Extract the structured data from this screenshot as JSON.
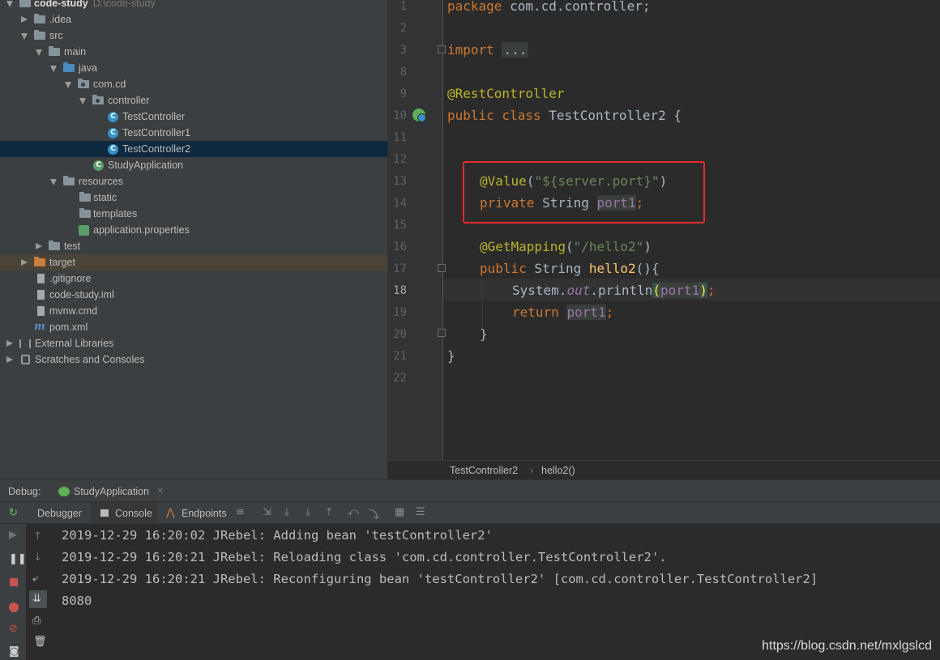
{
  "project_tree": {
    "root_label": "code-study",
    "root_path": "D:\\code-study",
    "items": [
      {
        "label": ".idea"
      },
      {
        "label": "src"
      },
      {
        "label": "main"
      },
      {
        "label": "java"
      },
      {
        "label": "com.cd"
      },
      {
        "label": "controller"
      },
      {
        "label": "TestController"
      },
      {
        "label": "TestController1"
      },
      {
        "label": "TestController2"
      },
      {
        "label": "StudyApplication"
      },
      {
        "label": "resources"
      },
      {
        "label": "static"
      },
      {
        "label": "templates"
      },
      {
        "label": "application.properties"
      },
      {
        "label": "test"
      },
      {
        "label": "target"
      },
      {
        "label": ".gitignore"
      },
      {
        "label": "code-study.iml"
      },
      {
        "label": "mvnw.cmd"
      },
      {
        "label": "pom.xml"
      },
      {
        "label": "External Libraries"
      },
      {
        "label": "Scratches and Consoles"
      }
    ]
  },
  "editor": {
    "line_numbers": [
      "1",
      "2",
      "3",
      "8",
      "9",
      "10",
      "11",
      "12",
      "13",
      "14",
      "15",
      "16",
      "17",
      "18",
      "19",
      "20",
      "21",
      "22"
    ],
    "code": {
      "l1_kw": "package",
      "l1_rest": " com.cd.controller;",
      "l3_kw": "import",
      "l3_fold": "...",
      "l9_ann": "@RestController",
      "l10_kw": "public class",
      "l10_rest": " TestController2 {",
      "l13_ann": "@Value",
      "l13_open": "(",
      "l13_str": "\"${server.port}\"",
      "l13_close": ")",
      "l14_kw": "private",
      "l14_type": " String ",
      "l14_fld": "port1",
      "l14_semi": ";",
      "l16_ann": "@GetMapping",
      "l16_open": "(",
      "l16_str": "\"/hello2\"",
      "l16_close": ")",
      "l17_kw": "public",
      "l17_type": " String ",
      "l17_mth": "hello2",
      "l17_rest": "(){",
      "l18_pre": "System.",
      "l18_out": "out",
      "l18_mid": ".println",
      "l18_po": "(",
      "l18_fld": "port1",
      "l18_pc": ")",
      "l18_semi": ";",
      "l19_kw": "return",
      "l19_sp": " ",
      "l19_fld": "port1",
      "l19_semi": ";",
      "l20": "}",
      "l21": "}"
    }
  },
  "breadcrumb": {
    "class_name": "TestController2",
    "method_name": "hello2()",
    "separator": "›"
  },
  "debug": {
    "label": "Debug:",
    "run_config": "StudyApplication",
    "tabs": [
      "Debugger",
      "Console",
      "Endpoints"
    ]
  },
  "console": {
    "lines": [
      "2019-12-29 16:20:02 JRebel: Adding bean 'testController2'",
      "2019-12-29 16:20:21 JRebel: Reloading class 'com.cd.controller.TestController2'.",
      "2019-12-29 16:20:21 JRebel: Reconfiguring bean 'testController2' [com.cd.controller.TestController2]",
      "8080"
    ]
  },
  "watermark": "https://blog.csdn.net/mxlgslcd",
  "colors": {
    "keyword": "#cc7832",
    "annotation": "#bbb529",
    "string": "#6a8759",
    "field": "#9876aa",
    "method": "#ffc66d",
    "highlight_box": "#e52b2b"
  }
}
